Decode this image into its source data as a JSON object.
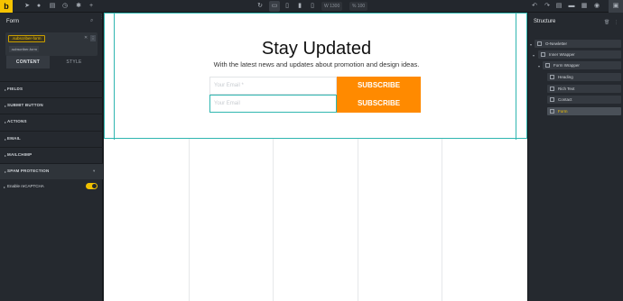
{
  "topbar": {
    "logo": "b",
    "width_value": "1300",
    "zoom_value": "100"
  },
  "left_panel": {
    "title": "Form",
    "selector_tag": ".subscriber-form",
    "selector_class": ".subscriber-form",
    "tabs": [
      {
        "label": "CONTENT"
      },
      {
        "label": "STYLE"
      }
    ],
    "sections": [
      {
        "label": "FIELDS"
      },
      {
        "label": "SUBMIT BUTTON"
      },
      {
        "label": "ACTIONS"
      },
      {
        "label": "EMAIL"
      },
      {
        "label": "MAILCHIMP"
      },
      {
        "label": "SPAM PROTECTION"
      }
    ],
    "recaptcha_label": "Enable reCAPTCHA"
  },
  "canvas": {
    "headline": "Stay Updated",
    "subline": "With the latest news and updates about promotion and design ideas.",
    "forms": [
      {
        "placeholder": "Your Email *",
        "button": "SUBSCRIBE"
      },
      {
        "placeholder": "Your Email",
        "button": "SUBSCRIBE"
      }
    ]
  },
  "structure": {
    "title": "Structure",
    "items": [
      {
        "label": "O-Newletter"
      },
      {
        "label": "Inner Wrapper"
      },
      {
        "label": "Form Wrapper"
      },
      {
        "label": "Heading"
      },
      {
        "label": "Rich Text"
      },
      {
        "label": "Contact"
      },
      {
        "label": "Form"
      }
    ]
  },
  "colors": {
    "accent": "#f0c000",
    "button": "#ff8a00",
    "selection": "#2fb6b0"
  }
}
